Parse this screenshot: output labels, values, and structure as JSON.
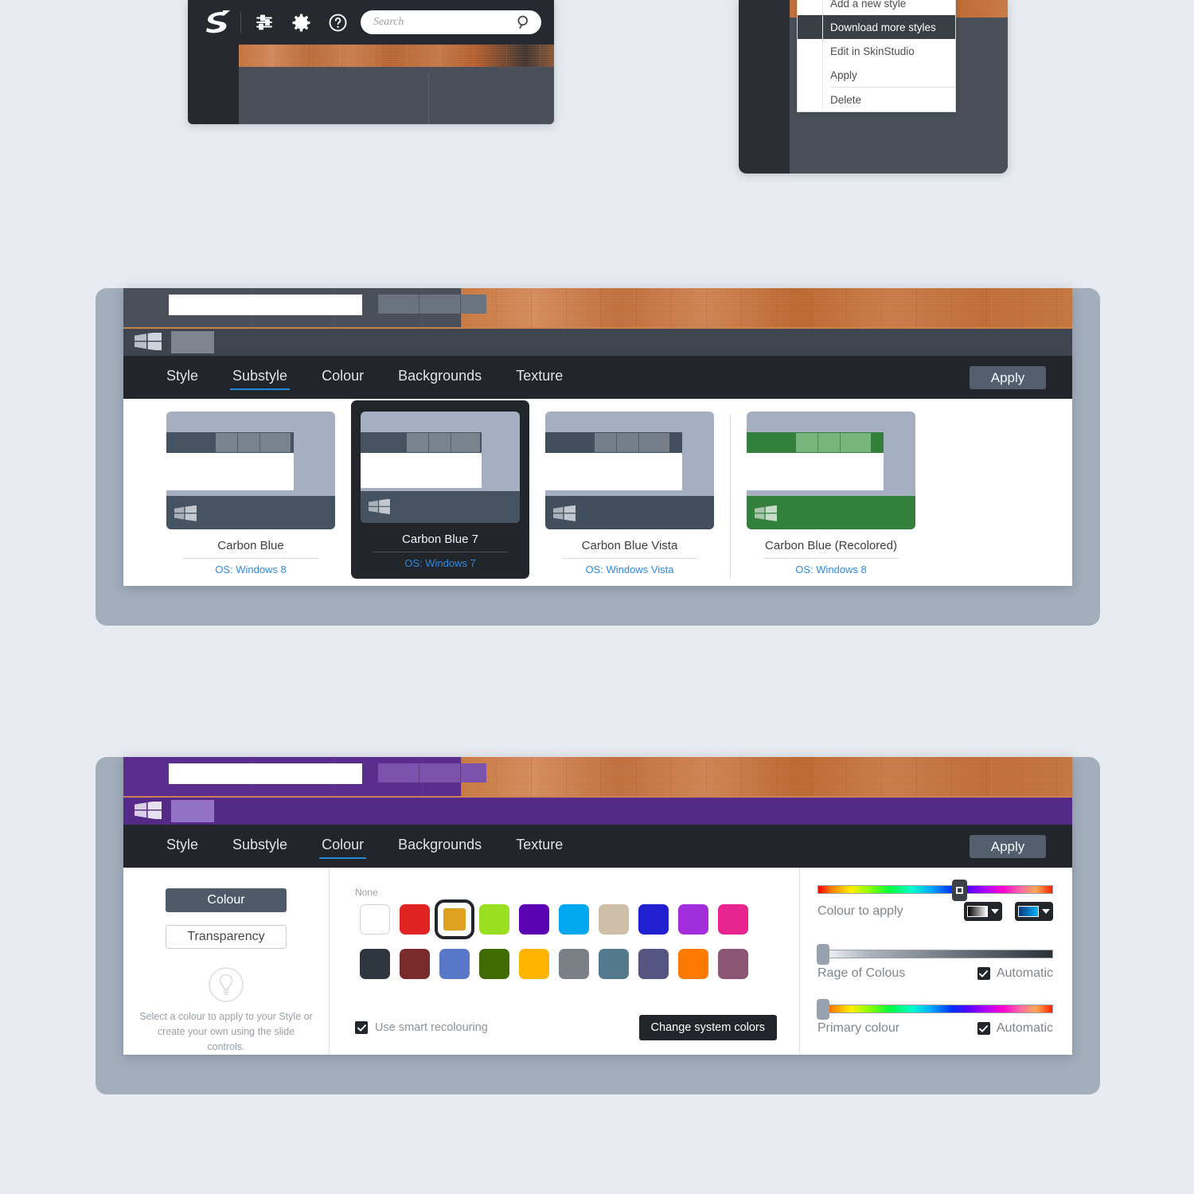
{
  "toolbar": {
    "logo": "stardock-s-logo",
    "icons": [
      "sliders-icon",
      "gear-icon",
      "help-icon"
    ],
    "search_placeholder": "Search",
    "search_value": "",
    "search_icon": "search-icon"
  },
  "context_menu": {
    "items": [
      {
        "label": "Add a new style",
        "highlighted": false,
        "separator_after": false
      },
      {
        "label": "Download more styles",
        "highlighted": true,
        "separator_after": false
      },
      {
        "label": "Edit in SkinStudio",
        "highlighted": false,
        "separator_after": false
      },
      {
        "label": "Apply",
        "highlighted": false,
        "separator_after": true
      },
      {
        "label": "Delete",
        "highlighted": false,
        "separator_after": false
      }
    ]
  },
  "tabs": [
    "Style",
    "Substyle",
    "Colour",
    "Backgrounds",
    "Texture"
  ],
  "apply_label": "Apply",
  "substyle_panel": {
    "active_tab": "Substyle",
    "preview_accent": "#4a4f59",
    "thumbnails": [
      {
        "name": "Carbon Blue",
        "os": "OS: Windows 8",
        "selected": false,
        "accent": "#455262",
        "frame": "#a4b0c1"
      },
      {
        "name": "Carbon Blue 7",
        "os": "OS: Windows 7",
        "selected": true,
        "accent": "#455262",
        "frame": "#a4b0c1"
      },
      {
        "name": "Carbon Blue Vista",
        "os": "OS: Windows Vista",
        "selected": false,
        "accent": "#414e5e",
        "frame": "#a4b0c1"
      },
      {
        "name": "Carbon Blue (Recolored)",
        "os": "OS: Windows 8",
        "selected": false,
        "accent": "#33803d",
        "frame": "#a4b0c1"
      }
    ]
  },
  "colour_panel": {
    "active_tab": "Colour",
    "preview_accent": "#5b2d8e",
    "left": {
      "colour_button": "Colour",
      "transparency_button": "Transparency",
      "bulb_icon": "lightbulb-icon",
      "hint": "Select a colour to apply to your Style or create your own using the slide controls."
    },
    "swatches": {
      "none_label": "None",
      "row1": [
        {
          "name": "none",
          "hex": "#ffffff",
          "selected": false
        },
        {
          "name": "red",
          "hex": "#e02424",
          "selected": false
        },
        {
          "name": "gold",
          "hex": "#dda01f",
          "selected": true
        },
        {
          "name": "lime",
          "hex": "#9ade20",
          "selected": false
        },
        {
          "name": "violet",
          "hex": "#5b02b5",
          "selected": false
        },
        {
          "name": "cyan",
          "hex": "#00a8f0",
          "selected": false
        },
        {
          "name": "tan",
          "hex": "#cfbfa9",
          "selected": false
        },
        {
          "name": "blue",
          "hex": "#2020d0",
          "selected": false
        },
        {
          "name": "purple",
          "hex": "#a12ddb",
          "selected": false
        },
        {
          "name": "pink",
          "hex": "#e8248f",
          "selected": false
        }
      ],
      "row2": [
        {
          "name": "charcoal",
          "hex": "#2f3640",
          "selected": false
        },
        {
          "name": "brick",
          "hex": "#792a2a",
          "selected": false
        },
        {
          "name": "cornflower",
          "hex": "#5a78c8",
          "selected": false
        },
        {
          "name": "olive",
          "hex": "#3f6b02",
          "selected": false
        },
        {
          "name": "amber",
          "hex": "#ffb400",
          "selected": false
        },
        {
          "name": "grey",
          "hex": "#7a8086",
          "selected": false
        },
        {
          "name": "steel-blue",
          "hex": "#53798c",
          "selected": false
        },
        {
          "name": "slate-purple",
          "hex": "#565480",
          "selected": false
        },
        {
          "name": "orange",
          "hex": "#ff7a00",
          "selected": false
        },
        {
          "name": "mauve",
          "hex": "#8b5574",
          "selected": false
        }
      ]
    },
    "smart_recolouring": {
      "label": "Use smart recolouring",
      "checked": true
    },
    "change_system_colors": "Change system colors",
    "sliders": [
      {
        "name": "Colour to apply",
        "type": "hue",
        "handle_pct": 57,
        "has_pickers": true,
        "automatic": null
      },
      {
        "name": "Rage of Colous",
        "type": "gray",
        "handle_pct": 1,
        "has_pickers": false,
        "automatic": "Automatic",
        "auto_checked": true
      },
      {
        "name": "Primary colour",
        "type": "hue",
        "handle_pct": 1,
        "has_pickers": false,
        "automatic": "Automatic",
        "auto_checked": true
      }
    ]
  }
}
